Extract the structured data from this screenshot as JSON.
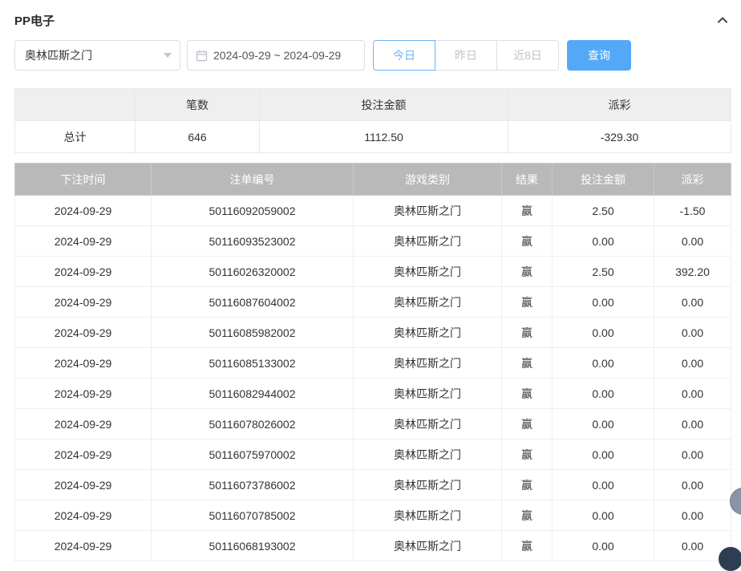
{
  "page": {
    "title": "PP电子"
  },
  "filters": {
    "game_select": "奥林匹斯之门",
    "date_range": "2024-09-29 ~ 2024-09-29",
    "quick_buttons": [
      {
        "label": "今日",
        "active": true
      },
      {
        "label": "昨日",
        "active": false
      },
      {
        "label": "近8日",
        "active": false
      }
    ],
    "query_label": "查询"
  },
  "summary": {
    "headers": [
      "",
      "笔数",
      "投注金额",
      "派彩"
    ],
    "row_label": "总计",
    "count": "646",
    "bet_amount": "1112.50",
    "payout": "-329.30"
  },
  "table": {
    "headers": [
      "下注时间",
      "注单编号",
      "游戏类别",
      "结果",
      "投注金额",
      "派彩"
    ],
    "rows": [
      [
        "2024-09-29",
        "50116092059002",
        "奥林匹斯之门",
        "赢",
        "2.50",
        "-1.50"
      ],
      [
        "2024-09-29",
        "50116093523002",
        "奥林匹斯之门",
        "赢",
        "0.00",
        "0.00"
      ],
      [
        "2024-09-29",
        "50116026320002",
        "奥林匹斯之门",
        "赢",
        "2.50",
        "392.20"
      ],
      [
        "2024-09-29",
        "50116087604002",
        "奥林匹斯之门",
        "赢",
        "0.00",
        "0.00"
      ],
      [
        "2024-09-29",
        "50116085982002",
        "奥林匹斯之门",
        "赢",
        "0.00",
        "0.00"
      ],
      [
        "2024-09-29",
        "50116085133002",
        "奥林匹斯之门",
        "赢",
        "0.00",
        "0.00"
      ],
      [
        "2024-09-29",
        "50116082944002",
        "奥林匹斯之门",
        "赢",
        "0.00",
        "0.00"
      ],
      [
        "2024-09-29",
        "50116078026002",
        "奥林匹斯之门",
        "赢",
        "0.00",
        "0.00"
      ],
      [
        "2024-09-29",
        "50116075970002",
        "奥林匹斯之门",
        "赢",
        "0.00",
        "0.00"
      ],
      [
        "2024-09-29",
        "50116073786002",
        "奥林匹斯之门",
        "赢",
        "0.00",
        "0.00"
      ],
      [
        "2024-09-29",
        "50116070785002",
        "奥林匹斯之门",
        "赢",
        "0.00",
        "0.00"
      ],
      [
        "2024-09-29",
        "50116068193002",
        "奥林匹斯之门",
        "赢",
        "0.00",
        "0.00"
      ]
    ]
  },
  "colors": {
    "accent_blue": "#54a9f7",
    "table_header_gray": "#b9b9b9",
    "negative_red": "#f25252"
  }
}
